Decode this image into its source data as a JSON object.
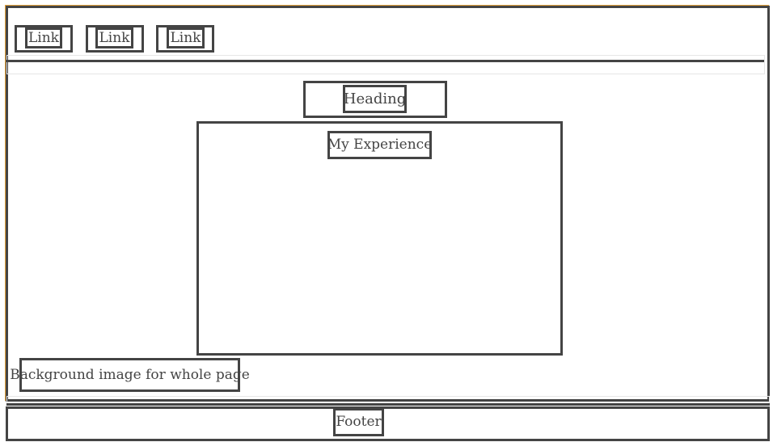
{
  "nav": {
    "links": [
      {
        "label": "Link"
      },
      {
        "label": "Link"
      },
      {
        "label": "Link"
      }
    ]
  },
  "main": {
    "heading": "Heading",
    "section_title": "My Experience",
    "background_note": "Background image for whole page"
  },
  "footer": {
    "label": "Footer"
  },
  "colors": {
    "border": "#444444",
    "accent_edge": "#e8a33c"
  }
}
